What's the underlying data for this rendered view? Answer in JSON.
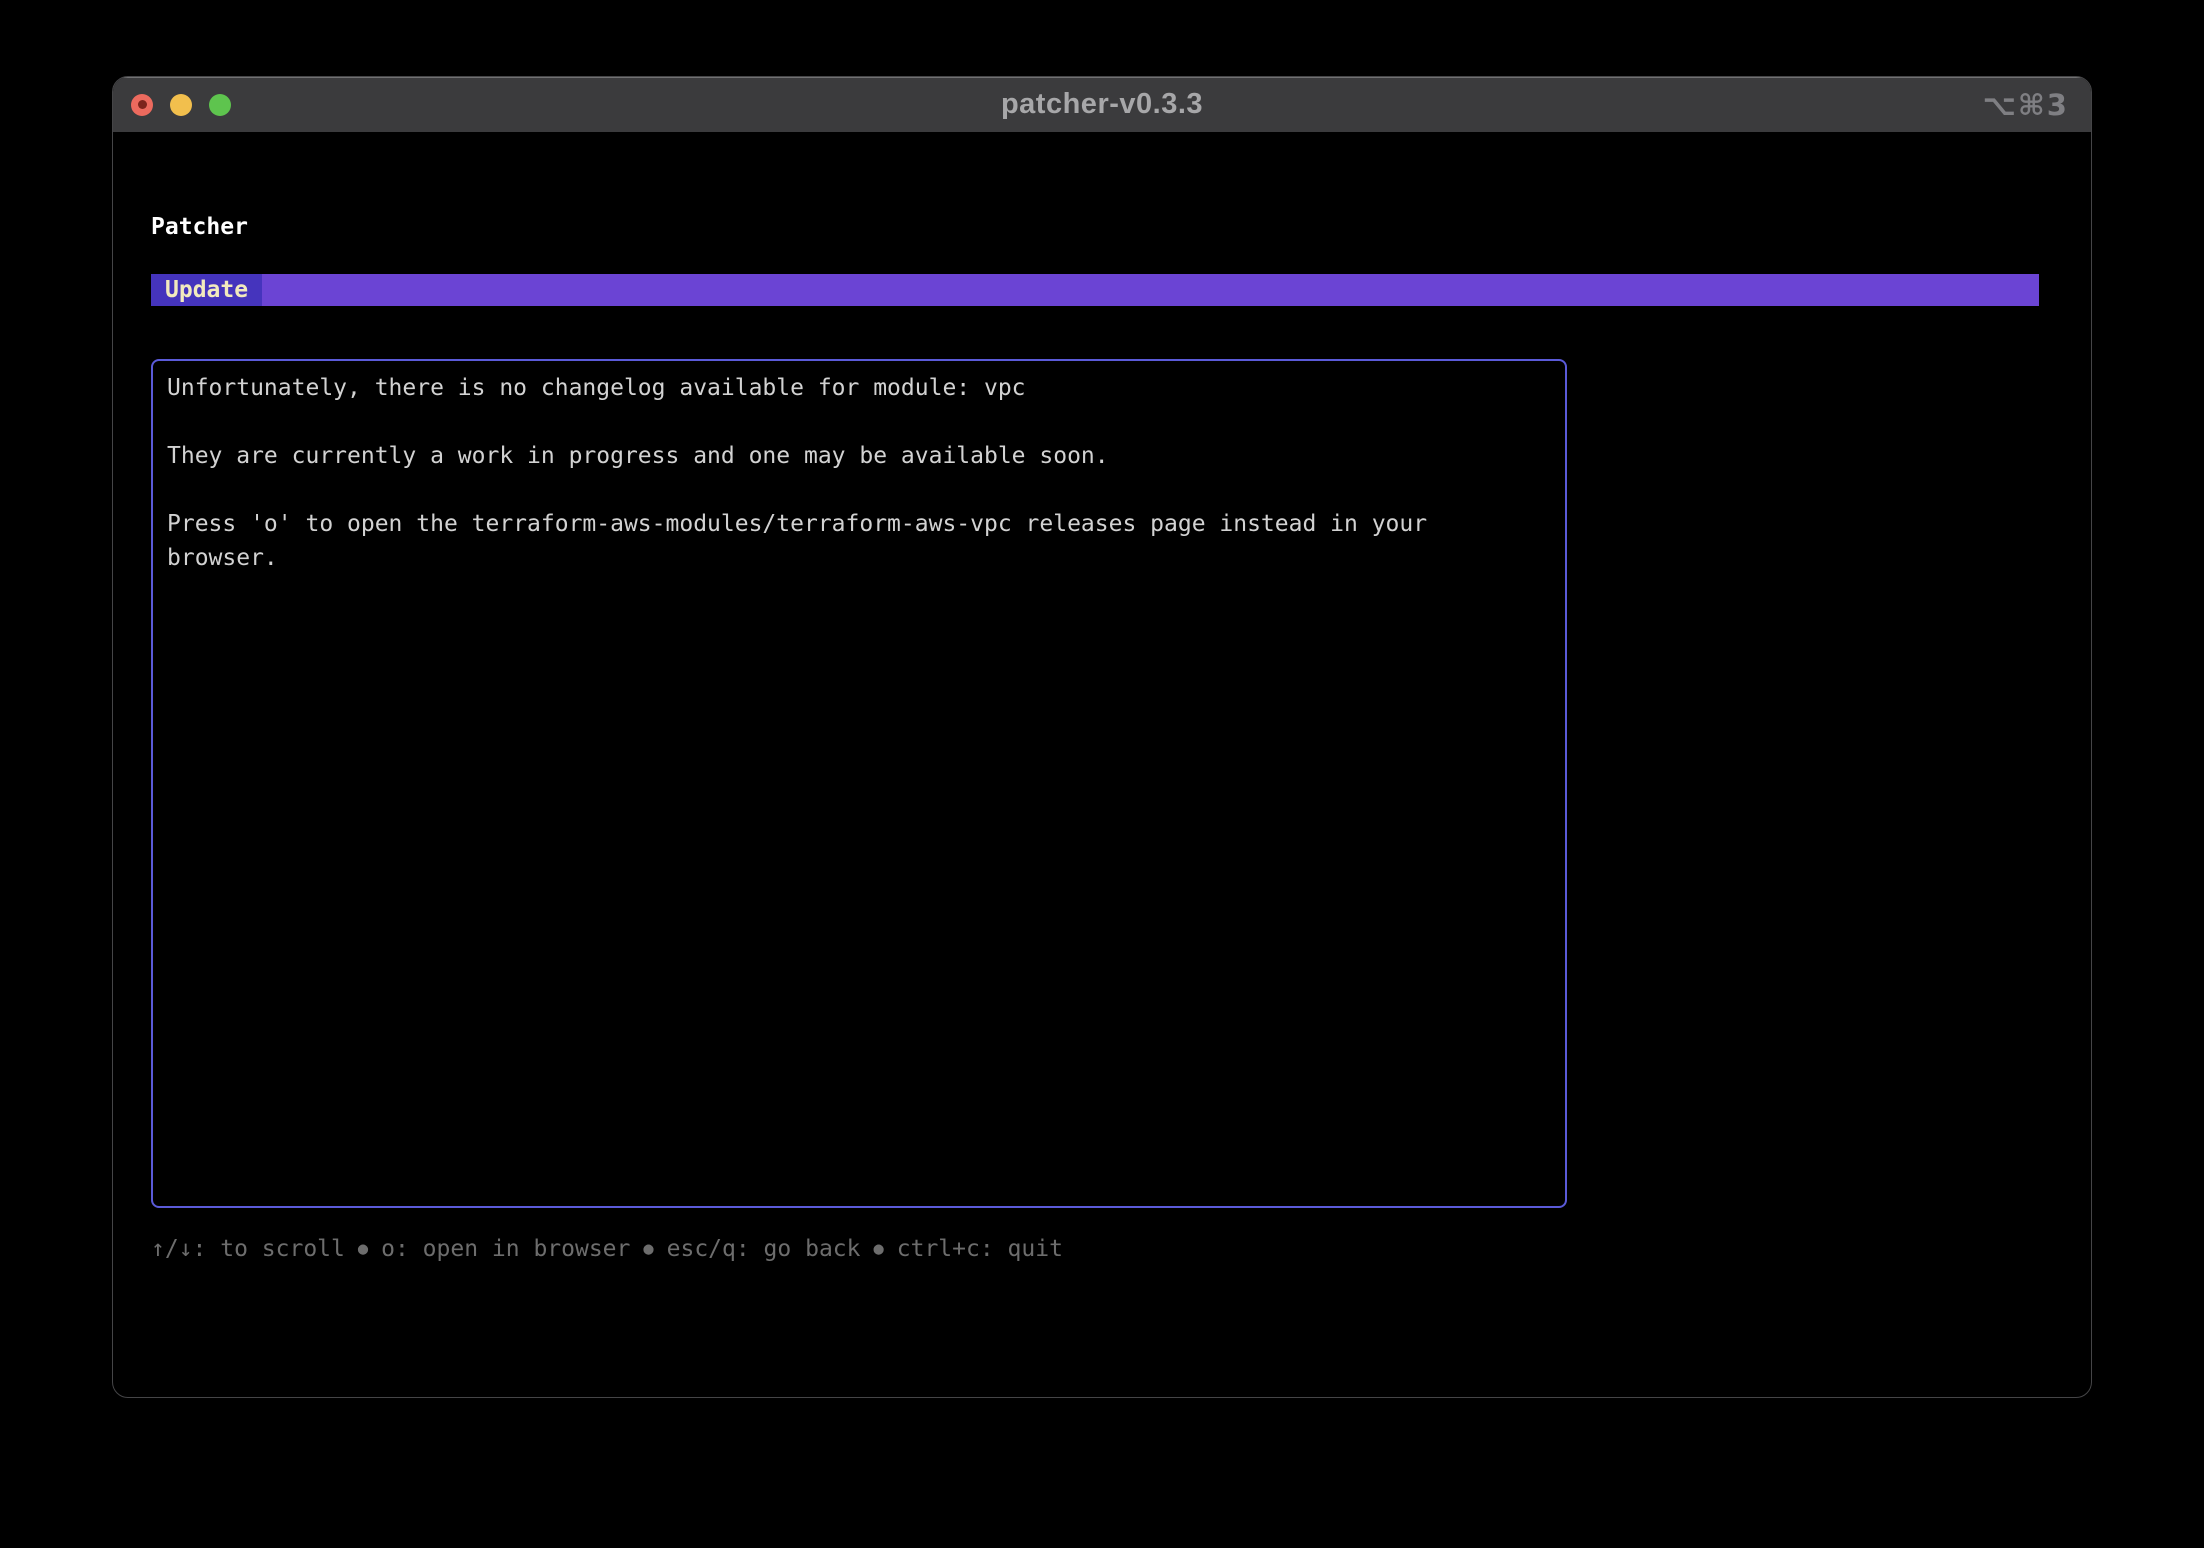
{
  "window": {
    "title": "patcher-v0.3.3",
    "shortcut_hint": "⌥⌘3"
  },
  "app": {
    "heading": "Patcher"
  },
  "tab_bar": {
    "active_tab": "Update"
  },
  "changelog": {
    "paragraphs": [
      "Unfortunately, there is no changelog available for module: vpc",
      "They are currently a work in progress and one may be available soon.",
      "Press 'o' to open the terraform-aws-modules/terraform-aws-vpc releases page instead in your browser."
    ]
  },
  "help": {
    "separator": "●",
    "items": [
      "↑/↓: to scroll",
      "o: open in browser",
      "esc/q: go back",
      "ctrl+c: quit"
    ]
  },
  "colors": {
    "titlebar_bg": "#3b3b3d",
    "terminal_bg": "#000000",
    "tab_active_bg": "#4534bd",
    "tab_bar_fill": "#6b44d4",
    "tab_active_text": "#f2eabe",
    "viewport_border": "#5a5ad8",
    "body_text": "#d2d2d2",
    "heading_text": "#ffffff",
    "help_text": "#6d6d6d",
    "window_title_text": "#a7a7a9",
    "traffic_close": "#ec6a5e",
    "traffic_minimize": "#f2bf4d",
    "traffic_zoom": "#5ec44e"
  }
}
